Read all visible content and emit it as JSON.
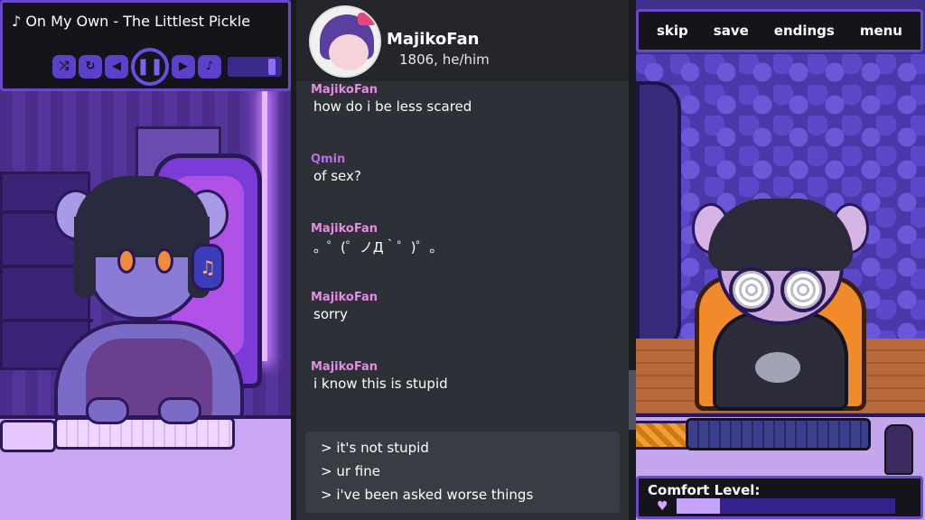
{
  "music_player": {
    "note_glyph": "♪",
    "song": "On My Own - The Littlest Pickle",
    "controls": [
      {
        "name": "shuffle-icon",
        "glyph": "⤮"
      },
      {
        "name": "repeat-icon",
        "glyph": "↻"
      },
      {
        "name": "previous-icon",
        "glyph": "◀"
      },
      {
        "name": "pause-icon",
        "glyph": "❚❚"
      },
      {
        "name": "next-icon",
        "glyph": "▶"
      },
      {
        "name": "volume-icon",
        "glyph": "♪"
      }
    ],
    "volume_level": 0.82
  },
  "chat": {
    "header": {
      "name": "MajikoFan",
      "subtitle": "1806, he/him"
    },
    "messages": [
      {
        "author": "MajikoFan",
        "text": "how do i be less scared"
      },
      {
        "author": "Qmin",
        "text": "of sex?"
      },
      {
        "author": "MajikoFan",
        "text": "。゜(゜ノД｀゜)゜。"
      },
      {
        "author": "MajikoFan",
        "text": "sorry"
      },
      {
        "author": "MajikoFan",
        "text": "i know this is stupid"
      }
    ],
    "choices": [
      "> it's not stupid",
      "> ur fine",
      "> i've been asked worse things"
    ]
  },
  "menu": {
    "skip": "skip",
    "save": "save",
    "endings": "endings",
    "menu": "menu"
  },
  "comfort": {
    "label": "Comfort Level:",
    "heart_glyph": "♥",
    "level": 0.2
  },
  "headphone_glyph": "♫",
  "colors": {
    "accent": "#6a48c8",
    "chat_bg": "#2e3037",
    "author_majiko": "#e48be6",
    "author_qmin": "#b96ae6",
    "comfort_fill": "#c6a5ff"
  }
}
